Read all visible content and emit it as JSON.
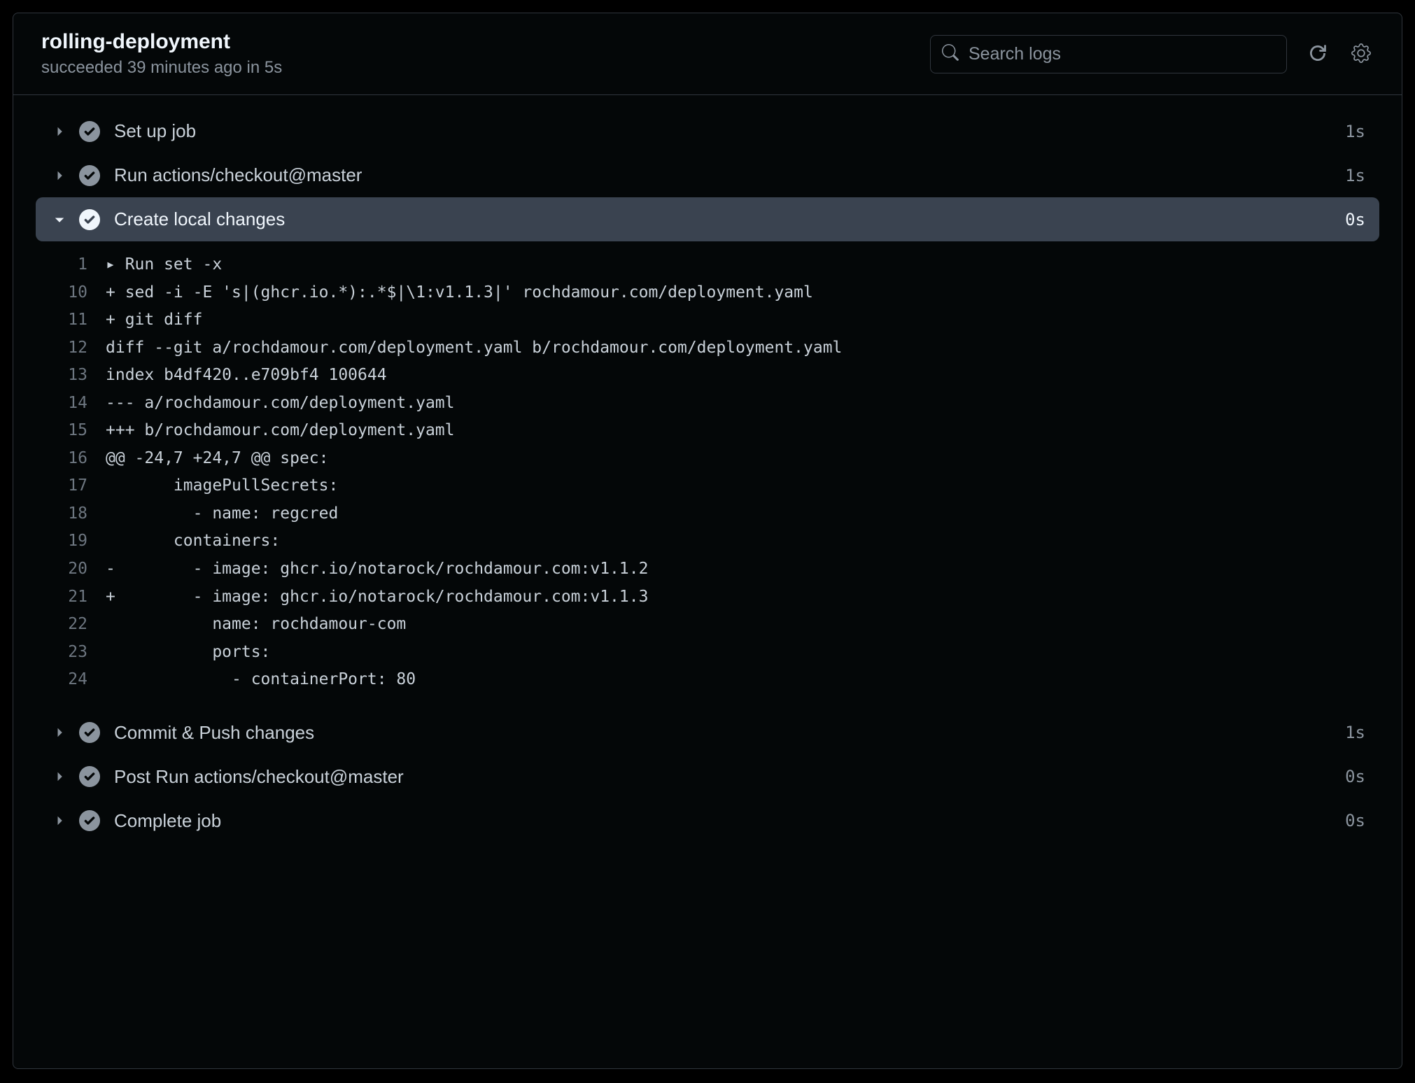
{
  "header": {
    "title": "rolling-deployment",
    "subtitle": "succeeded 39 minutes ago in 5s",
    "search_placeholder": "Search logs"
  },
  "steps": [
    {
      "name": "Set up job",
      "duration": "1s",
      "expanded": false
    },
    {
      "name": "Run actions/checkout@master",
      "duration": "1s",
      "expanded": false
    },
    {
      "name": "Create local changes",
      "duration": "0s",
      "expanded": true
    },
    {
      "name": "Commit & Push changes",
      "duration": "1s",
      "expanded": false
    },
    {
      "name": "Post Run actions/checkout@master",
      "duration": "0s",
      "expanded": false
    },
    {
      "name": "Complete job",
      "duration": "0s",
      "expanded": false
    }
  ],
  "log": {
    "lines": [
      {
        "n": "1",
        "t": "▸ Run set -x"
      },
      {
        "n": "10",
        "t": "+ sed -i -E 's|(ghcr.io.*):.*$|\\1:v1.1.3|' rochdamour.com/deployment.yaml"
      },
      {
        "n": "11",
        "t": "+ git diff"
      },
      {
        "n": "12",
        "t": "diff --git a/rochdamour.com/deployment.yaml b/rochdamour.com/deployment.yaml"
      },
      {
        "n": "13",
        "t": "index b4df420..e709bf4 100644"
      },
      {
        "n": "14",
        "t": "--- a/rochdamour.com/deployment.yaml"
      },
      {
        "n": "15",
        "t": "+++ b/rochdamour.com/deployment.yaml"
      },
      {
        "n": "16",
        "t": "@@ -24,7 +24,7 @@ spec:"
      },
      {
        "n": "17",
        "t": "       imagePullSecrets:"
      },
      {
        "n": "18",
        "t": "         - name: regcred"
      },
      {
        "n": "19",
        "t": "       containers:"
      },
      {
        "n": "20",
        "t": "-        - image: ghcr.io/notarock/rochdamour.com:v1.1.2"
      },
      {
        "n": "21",
        "t": "+        - image: ghcr.io/notarock/rochdamour.com:v1.1.3"
      },
      {
        "n": "22",
        "t": "           name: rochdamour-com"
      },
      {
        "n": "23",
        "t": "           ports:"
      },
      {
        "n": "24",
        "t": "             - containerPort: 80"
      }
    ]
  }
}
